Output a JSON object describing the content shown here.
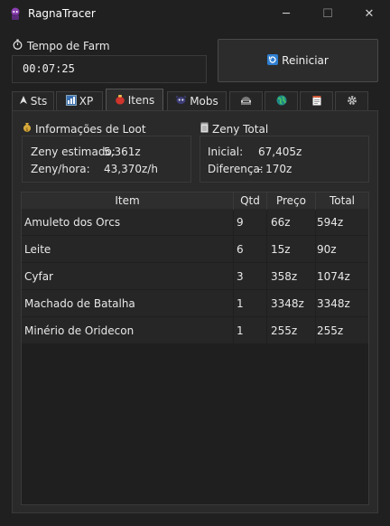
{
  "window": {
    "title": "RagnaTracer",
    "minimize": "─",
    "maximize": "☐",
    "close": "✕"
  },
  "farm": {
    "label": "Tempo de Farm",
    "time": "00:07:25",
    "restart_label": "Reiniciar"
  },
  "tabs": [
    {
      "label": "Sts",
      "icon": "chart-icon"
    },
    {
      "label": "XP",
      "icon": "xp-icon"
    },
    {
      "label": "Itens",
      "icon": "bag-icon",
      "active": true
    },
    {
      "label": "Mobs",
      "icon": "monster-icon"
    },
    {
      "label": "",
      "icon": "helmet-icon"
    },
    {
      "label": "",
      "icon": "globe-icon"
    },
    {
      "label": "",
      "icon": "notes-icon"
    },
    {
      "label": "",
      "icon": "gear-icon"
    }
  ],
  "loot": {
    "title": "Informações de Loot",
    "zeny_estimado_label": "Zeny estimado:",
    "zeny_estimado_value": "5,361z",
    "zeny_hora_label": "Zeny/hora:",
    "zeny_hora_value": "43,370z/h"
  },
  "zeny_total": {
    "title": "Zeny Total",
    "inicial_label": "Inicial:",
    "inicial_value": "67,405z",
    "diferenca_label": "Diferença:",
    "diferenca_value": "- 170z"
  },
  "table": {
    "headers": [
      "Item",
      "Qtd",
      "Preço",
      "Total"
    ],
    "rows": [
      {
        "item": "Amuleto dos Orcs",
        "qtd": "9",
        "preco": "66z",
        "total": "594z"
      },
      {
        "item": "Leite",
        "qtd": "6",
        "preco": "15z",
        "total": "90z"
      },
      {
        "item": "Cyfar",
        "qtd": "3",
        "preco": "358z",
        "total": "1074z"
      },
      {
        "item": "Machado de Batalha",
        "qtd": "1",
        "preco": "3348z",
        "total": "3348z"
      },
      {
        "item": "Minério de Oridecon",
        "qtd": "1",
        "preco": "255z",
        "total": "255z"
      }
    ]
  }
}
